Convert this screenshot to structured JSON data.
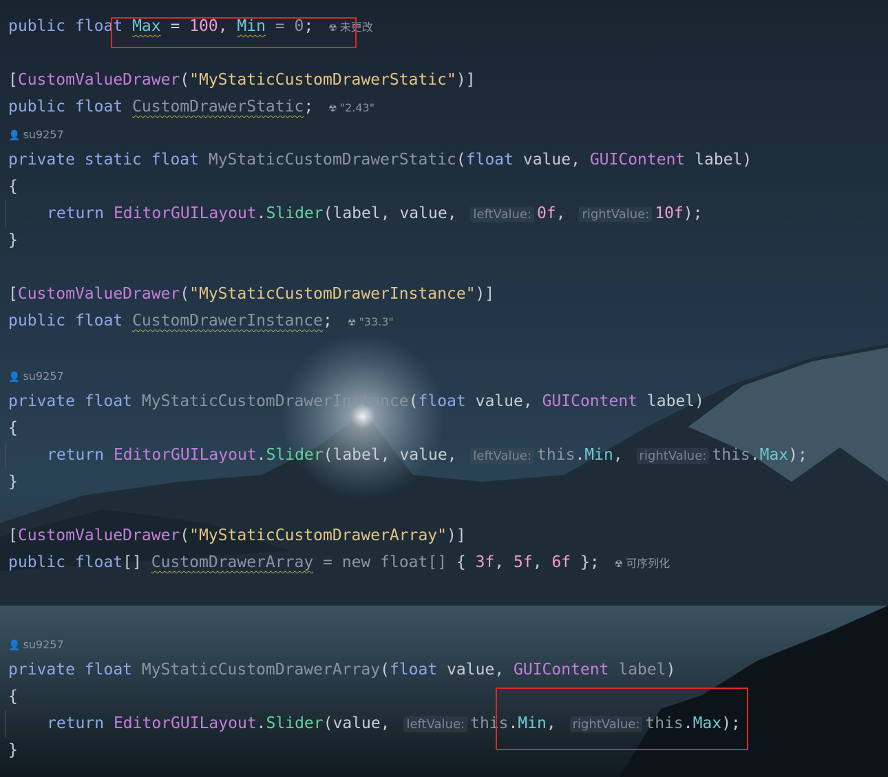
{
  "code": {
    "kw_public": "public",
    "kw_private": "private",
    "kw_static": "static",
    "kw_float": "float",
    "kw_return": "return",
    "kw_new": "new",
    "attr_name": "CustomValueDrawer",
    "line1": {
      "field_max": "Max",
      "val_max": "100",
      "field_min": "Min",
      "val_min": "0",
      "annotation": "未更改"
    },
    "block1": {
      "attr_arg": "\"MyStaticCustomDrawerStatic\"",
      "field": "CustomDrawerStatic",
      "annotation": "\"2.43\"",
      "author": "su9257",
      "method": "MyStaticCustomDrawerStatic",
      "param_type": "GUIContent",
      "call_class": "EditorGUILayout",
      "call_method": "Slider",
      "hint_left": "leftValue:",
      "left_val": "0f",
      "hint_right": "rightValue:",
      "right_val": "10f"
    },
    "block2": {
      "attr_arg": "\"MyStaticCustomDrawerInstance\"",
      "field": "CustomDrawerInstance",
      "annotation": "\"33.3\"",
      "author": "su9257",
      "method": "MyStaticCustomDrawerInstance",
      "this_kw": "this",
      "min_field": "Min",
      "max_field": "Max"
    },
    "block3": {
      "attr_arg": "\"MyStaticCustomDrawerArray\"",
      "field": "CustomDrawerArray",
      "arr_type": "float[]",
      "v1": "3f",
      "v2": "5f",
      "v3": "6f",
      "annotation": "可序列化",
      "author": "su9257",
      "method": "MyStaticCustomDrawerArray"
    },
    "tokens": {
      "brace_open": "{",
      "brace_close": "}",
      "bracket_open": "[",
      "bracket_close": "]",
      "paren_open": "(",
      "paren_close": ")",
      "array_suffix": "[]",
      "value_param": "value",
      "label_param": "label",
      "dot": ".",
      "comma_space": ", ",
      "eq": " = ",
      "semicolon": ";",
      "end_call": ");",
      "attr_close": ")]"
    }
  },
  "colors": {
    "highlight_box": "#e0262a",
    "background": "#1c2834"
  },
  "icons": {
    "annotation": "radiation-icon",
    "author": "person-icon"
  }
}
